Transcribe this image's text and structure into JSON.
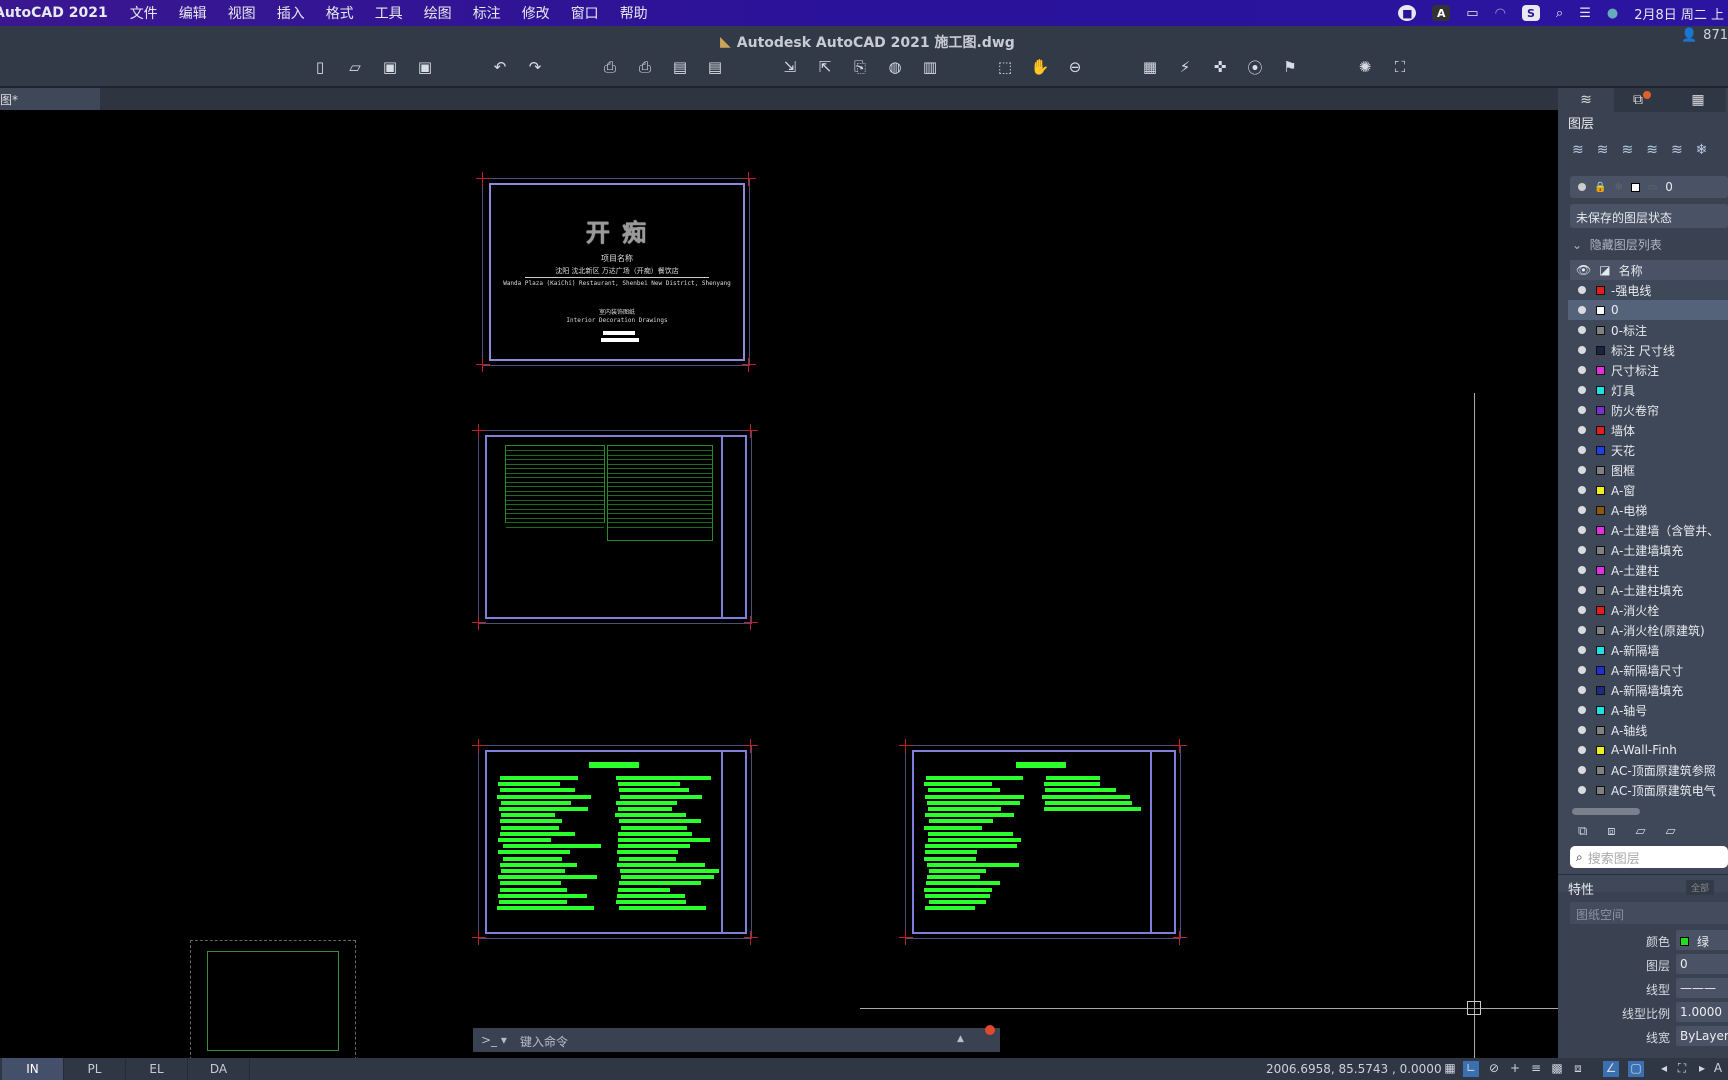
{
  "menubar": {
    "app": "AutoCAD 2021",
    "items": [
      "文件",
      "编辑",
      "视图",
      "插入",
      "格式",
      "工具",
      "绘图",
      "标注",
      "修改",
      "窗口",
      "帮助"
    ],
    "date": "2月8日 周二 上"
  },
  "titlebar": {
    "title": "Autodesk AutoCAD 2021   施工图.dwg",
    "user": "871"
  },
  "doc_tab": {
    "label": "图*"
  },
  "cover_sheet": {
    "title": "开 痴",
    "project_label": "项目名称",
    "project_cn": "沈阳 沈北新区 万达广场（开痴）餐饮店",
    "project_en": "Wanda Plaza (KaiChi) Restaurant, Shenbei New District, Shenyang",
    "drawing_cn": "室内装饰图纸",
    "drawing_en": "Interior Decoration Drawings"
  },
  "layers_panel": {
    "title": "图层",
    "current_layer": "0",
    "layer_state": "未保存的图层状态",
    "hidden_list": "隐藏图层列表",
    "column_name": "名称",
    "search_placeholder": "搜索图层",
    "layers": [
      {
        "name": "-强电线",
        "color": "#e02020"
      },
      {
        "name": "0",
        "color": "#ffffff",
        "selected": true
      },
      {
        "name": "0-标注",
        "color": "#808080"
      },
      {
        "name": "标注 尺寸线",
        "color": "#1a2440"
      },
      {
        "name": "尺寸标注",
        "color": "#e030e0"
      },
      {
        "name": "灯具",
        "color": "#20e0e0"
      },
      {
        "name": "防火卷帘",
        "color": "#7a30d0"
      },
      {
        "name": "墙体",
        "color": "#e02020"
      },
      {
        "name": "天花",
        "color": "#2040e0"
      },
      {
        "name": "图框",
        "color": "#808080"
      },
      {
        "name": "A-窗",
        "color": "#f0f020"
      },
      {
        "name": "A-电梯",
        "color": "#8a5a10"
      },
      {
        "name": "A-土建墙（含管井、",
        "color": "#e030e0"
      },
      {
        "name": "A-土建墙填充",
        "color": "#808080"
      },
      {
        "name": "A-土建柱",
        "color": "#e030e0"
      },
      {
        "name": "A-土建柱填充",
        "color": "#808080"
      },
      {
        "name": "A-消火栓",
        "color": "#e02020"
      },
      {
        "name": "A-消火栓(原建筑)",
        "color": "#808080"
      },
      {
        "name": "A-新隔墙",
        "color": "#20e0e0"
      },
      {
        "name": "A-新隔墙尺寸",
        "color": "#2030d0"
      },
      {
        "name": "A-新隔墙填充",
        "color": "#202a80"
      },
      {
        "name": "A-轴号",
        "color": "#20e0e0"
      },
      {
        "name": "A-轴线",
        "color": "#808080"
      },
      {
        "name": "A-Wall-Finh",
        "color": "#f0f020"
      },
      {
        "name": "AC-顶面原建筑参照",
        "color": "#808080"
      },
      {
        "name": "AC-顶面原建筑电气",
        "color": "#808080"
      }
    ]
  },
  "properties_panel": {
    "title": "特性",
    "all_button": "全部",
    "space": "图纸空间",
    "rows": [
      {
        "label": "颜色",
        "value": "绿",
        "swatch": "#22dd22"
      },
      {
        "label": "图层",
        "value": "0"
      },
      {
        "label": "线型",
        "value": "———"
      },
      {
        "label": "线型比例",
        "value": "1.0000"
      },
      {
        "label": "线宽",
        "value": "ByLayer"
      }
    ]
  },
  "command_line": {
    "prompt": ">_ ▾",
    "placeholder": "键入命令"
  },
  "statusbar": {
    "layout_tabs": [
      "IN",
      "PL",
      "EL",
      "DA"
    ],
    "active_tab": "IN",
    "coordinates": "2006.6958, 85.5743 , 0.0000"
  }
}
